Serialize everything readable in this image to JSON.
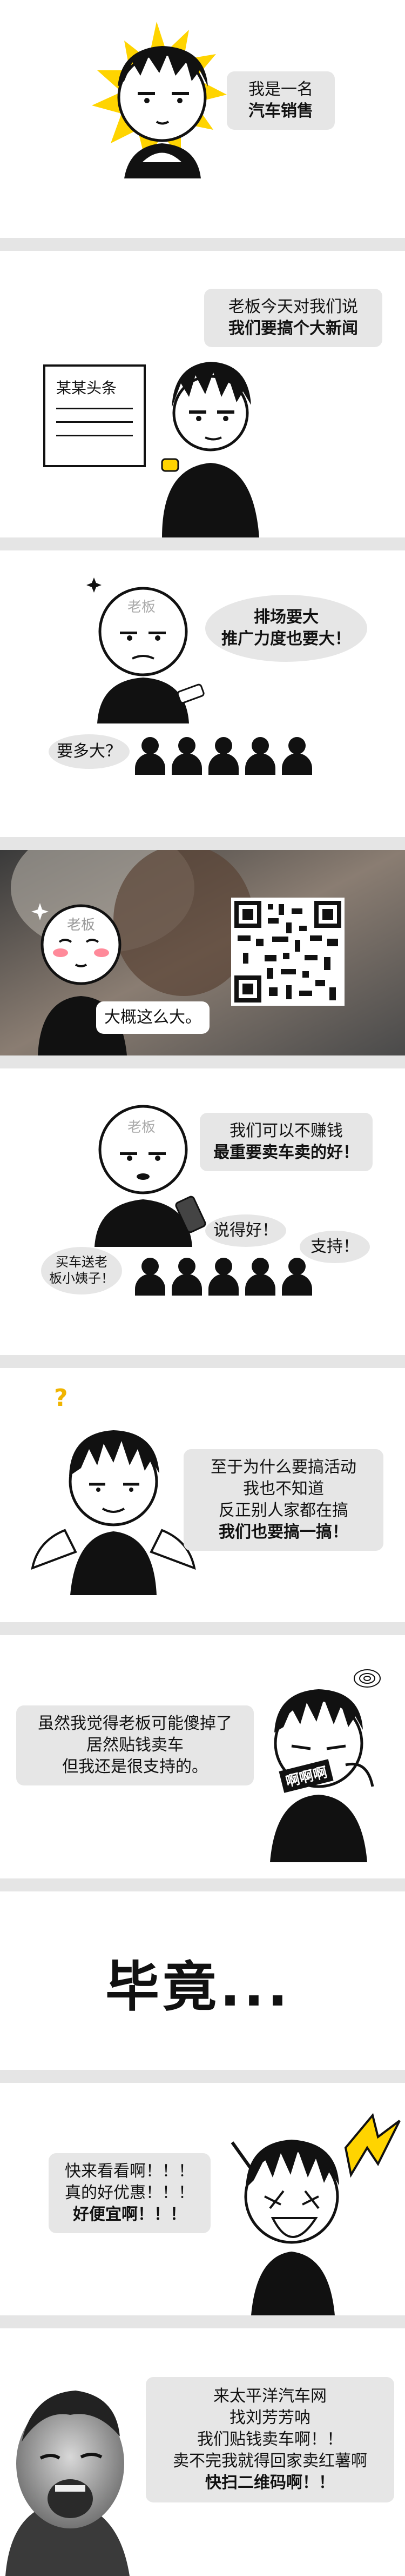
{
  "panels": {
    "p1": {
      "lines": [
        "我是一名",
        "汽车销售"
      ]
    },
    "p2": {
      "lines": [
        "老板今天对我们说",
        "我们要搞个大新闻"
      ],
      "paper_title": "某某头条"
    },
    "p3": {
      "boss_label": "老板",
      "bubble_lines": [
        "排场要大",
        "推广力度也要大！"
      ],
      "question": "要多大？"
    },
    "p4": {
      "boss_label": "老板",
      "caption": "大概这么大。"
    },
    "p5": {
      "boss_label": "老板",
      "bubble_lines": [
        "我们可以不赚钱",
        "最重要卖车卖的好！"
      ],
      "reply_1": "说得好！",
      "reply_2": "支持！",
      "reply_3_lines": [
        "买车送老",
        "板小姨子！"
      ]
    },
    "p6": {
      "bubble_lines": [
        "至于为什么要搞活动",
        "我也不知道",
        "反正别人家都在搞",
        "我们也要搞一搞！"
      ]
    },
    "p7": {
      "bubble_lines": [
        "虽然我觉得老板可能傻掉了",
        "居然贴钱卖车",
        "但我还是很支持的。"
      ],
      "tag": "啊啊啊"
    },
    "p8": {
      "title": "毕竟..."
    },
    "p9": {
      "bubble_lines": [
        "快来看看啊！！！",
        "真的好优惠！！！",
        "好便宜啊！！！"
      ]
    },
    "p10": {
      "bubble_lines": [
        "来太平洋汽车网",
        "找刘芳芳呐",
        "我们贴钱卖车啊！！",
        "卖不完我就得回家卖红薯啊",
        "快扫二维码啊！！"
      ]
    }
  },
  "colors": {
    "bubble": "#e6e6e6",
    "separator": "#e5e5e5",
    "sunburst": "#ffd400",
    "blush": "#ff8a9a"
  }
}
